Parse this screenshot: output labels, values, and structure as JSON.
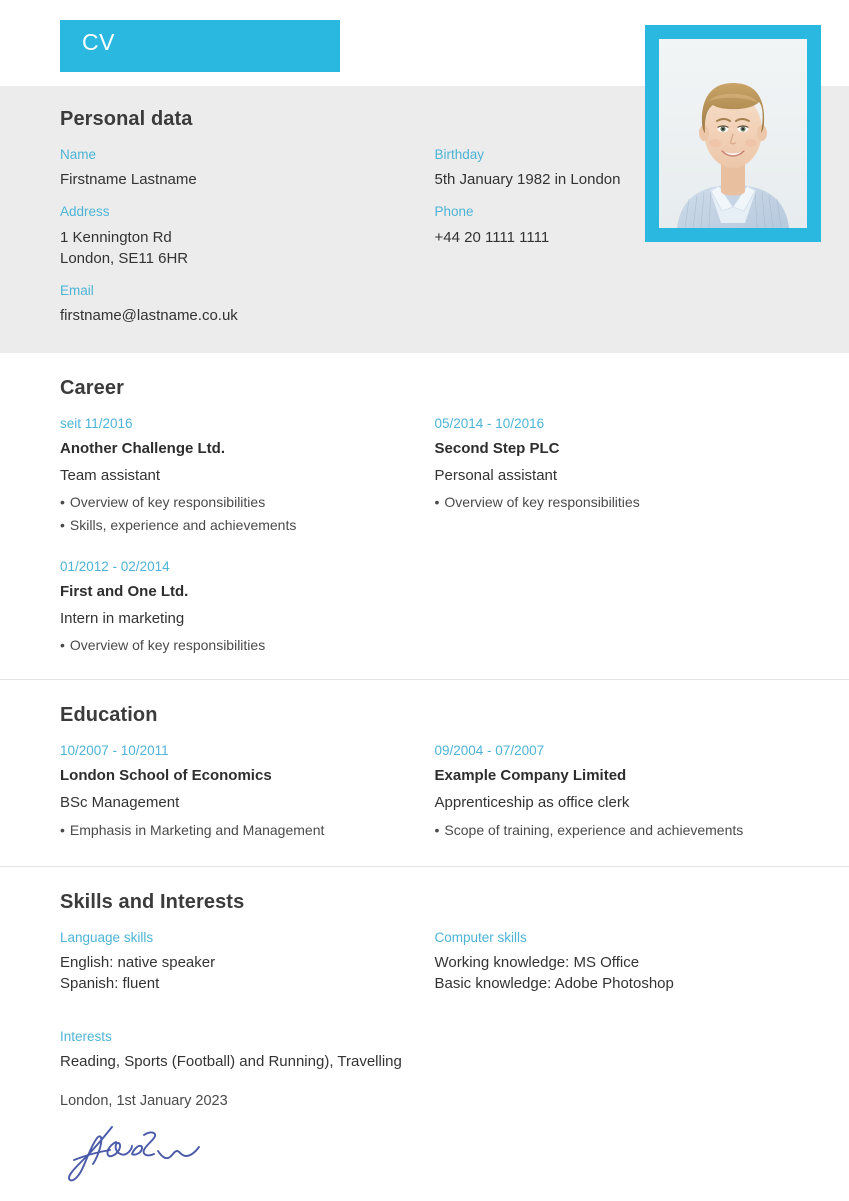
{
  "document": {
    "banner_label": "CV",
    "accent_color": "#2bb8e0",
    "label_color": "#4db4d6"
  },
  "photo": {
    "alt_name": "portrait-photo"
  },
  "personal": {
    "title": "Personal data",
    "fields": [
      {
        "label": "Name",
        "value": "Firstname Lastname"
      },
      {
        "label": "Address",
        "value": "1 Kennington Rd\nLondon, SE11 6HR"
      },
      {
        "label": "Email",
        "value": "firstname@lastname.co.uk"
      },
      {
        "label": "Birthday",
        "value": "5th January 1982 in London"
      },
      {
        "label": "Phone",
        "value": "+44 20 1111 1111"
      }
    ]
  },
  "career": {
    "title": "Career",
    "entries": [
      {
        "date": "seit 11/2016",
        "organisation": "Another Challenge Ltd.",
        "role": "Team assistant",
        "bullets": [
          "Overview of key responsibilities",
          "Skills, experience and achievements"
        ]
      },
      {
        "date": "05/2014 - 10/2016",
        "organisation": "Second Step PLC",
        "role": "Personal assistant",
        "bullets": [
          "Overview of key responsibilities"
        ]
      },
      {
        "date": "01/2012 - 02/2014",
        "organisation": "First and One Ltd.",
        "role": "Intern in marketing",
        "bullets": [
          "Overview of key responsibilities"
        ]
      }
    ]
  },
  "education": {
    "title": "Education",
    "entries": [
      {
        "date": "10/2007 - 10/2011",
        "organisation": "London School of Economics",
        "role": "BSc Management",
        "bullets": [
          "Emphasis in Marketing and Management"
        ]
      },
      {
        "date": "09/2004 - 07/2007",
        "organisation": "Example Company Limited",
        "role": "Apprenticeship as office clerk",
        "bullets": [
          "Scope of training, experience and achievements"
        ]
      }
    ]
  },
  "skills": {
    "title": "Skills and Interests",
    "language": {
      "label": "Language skills",
      "value": "English: native speaker\nSpanish: fluent"
    },
    "computer": {
      "label": "Computer skills",
      "value": "Working knowledge: MS Office\nBasic knowledge: Adobe Photoshop"
    },
    "interests": {
      "label": "Interests",
      "value": "Reading, Sports (Football) and Running), Travelling"
    }
  },
  "footer": {
    "place_date": "London, 1st January 2023",
    "signature_name": "handwritten-signature"
  }
}
